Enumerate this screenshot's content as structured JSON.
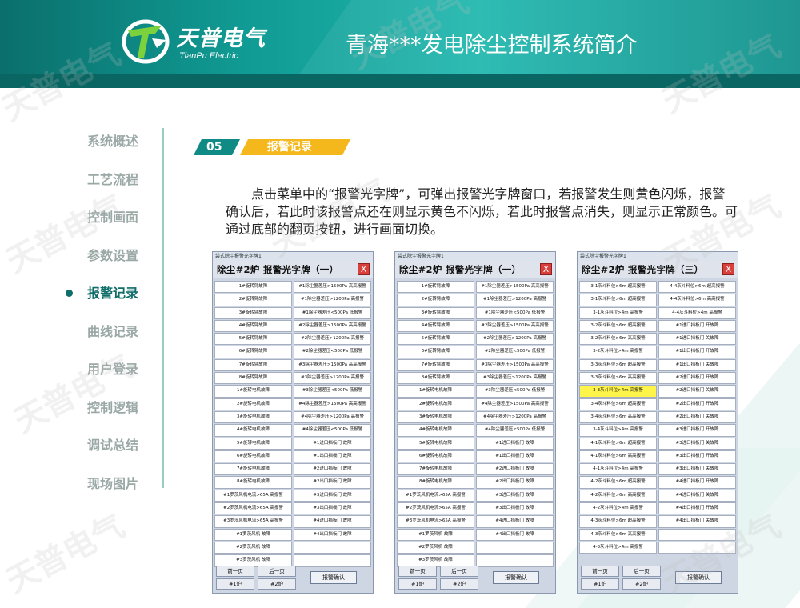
{
  "header": {
    "brand_cn": "天普电气",
    "brand_en": "TianPu Electric",
    "title": "青海***发电除尘控制系统简介"
  },
  "watermark": "天普电气",
  "nav": {
    "items": [
      {
        "label": "系统概述"
      },
      {
        "label": "工艺流程"
      },
      {
        "label": "控制画面"
      },
      {
        "label": "参数设置"
      },
      {
        "label": "报警记录",
        "active": true
      },
      {
        "label": "曲线记录"
      },
      {
        "label": "用户登录"
      },
      {
        "label": "控制逻辑"
      },
      {
        "label": "调试总结"
      },
      {
        "label": "现场图片"
      }
    ]
  },
  "section": {
    "number": "05",
    "name": "报警记录"
  },
  "description": "点击菜单中的“报警光字牌”，可弹出报警光字牌窗口，若报警发生则黄色闪烁，报警确认后，若此时该报警点还在则显示黄色不闪烁，若此时报警点消失，则显示正常颜色。可通过底部的翻页按钮，进行画面切换。",
  "colors": {
    "accent": "#0f8a85",
    "tag_yellow": "#f5b81c",
    "alarm_yellow": "#fff54a"
  },
  "windows": [
    {
      "bar": "袋式除尘报警光字牌1",
      "title": "除尘#2炉 报警光字牌（一）",
      "close": "X",
      "cells": [
        "1#旋转臂故障",
        "#1除尘器差压>1500Pa 高高报警",
        "2#旋转臂故障",
        "#1除尘器差压>1200Pa 高报警",
        "3#旋转臂故障",
        "#1除尘器差压<500Pa 低报警",
        "4#旋转臂故障",
        "#2除尘器差压>1500Pa 高高报警",
        "5#旋转臂故障",
        "#2除尘器差压>1200Pa 高报警",
        "6#旋转臂故障",
        "#2除尘器差压<500Pa 低报警",
        "7#旋转臂故障",
        "#3除尘器差压>1500Pa 高高报警",
        "8#旋转臂故障",
        "#3除尘器差压>1200Pa 高报警",
        "1#旋转电机故障",
        "#3除尘器差压<500Pa 低报警",
        "2#旋转电机故障",
        "#4除尘器差压>1500Pa 高高报警",
        "3#旋转电机故障",
        "#4除尘器差压>1200Pa 高报警",
        "4#旋转电机故障",
        "#4除尘器差压<500Pa 低报警",
        "5#旋转电机故障",
        "#1进口挡板门 故障",
        "6#旋转电机故障",
        "#1出口挡板门 故障",
        "7#旋转电机故障",
        "#2进口挡板门 故障",
        "8#旋转电机故障",
        "#2出口挡板门 故障",
        "#1罗茨风机电流>65A 高报警",
        "#3进口挡板门 故障",
        "#2罗茨风机电流>65A 高报警",
        "#3出口挡板门 故障",
        "#3罗茨风机电流>65A 高报警",
        "#4进口挡板门 故障",
        "#1罗茨风机 故障",
        "#4出口挡板门 故障",
        "#2罗茨风机 故障",
        "",
        "#3罗茨风机 故障",
        ""
      ],
      "prev": "前一页",
      "next": "后一页",
      "tab1": "#1炉",
      "tab2": "#2炉",
      "ack": "报警确认"
    },
    {
      "bar": "袋式除尘报警光字牌1",
      "title": "除尘#2炉 报警光字牌（一）",
      "close": "X",
      "cells": [
        "1#旋转臂故障",
        "#1除尘器差压>1500Pa 高高报警",
        "2#旋转臂故障",
        "#1除尘器差压>1200Pa 高报警",
        "3#旋转臂故障",
        "#1除尘器差压<500Pa 低报警",
        "4#旋转臂故障",
        "#2除尘器差压>1500Pa 高高报警",
        "5#旋转臂故障",
        "#2除尘器差压>1200Pa 高报警",
        "6#旋转臂故障",
        "#2除尘器差压<500Pa 低报警",
        "7#旋转臂故障",
        "#3除尘器差压>1500Pa 高高报警",
        "8#旋转臂故障",
        "#3除尘器差压>1200Pa 高报警",
        "1#旋转电机故障",
        "#3除尘器差压<500Pa 低报警",
        "2#旋转电机故障",
        "#4除尘器差压>1500Pa 高高报警",
        "3#旋转电机故障",
        "#4除尘器差压>1200Pa 高报警",
        "4#旋转电机故障",
        "#4除尘器差压<500Pa 低报警",
        "5#旋转电机故障",
        "#1进口挡板门 故障",
        "6#旋转电机故障",
        "#1出口挡板门 故障",
        "7#旋转电机故障",
        "#2进口挡板门 故障",
        "8#旋转电机故障",
        "#2出口挡板门 故障",
        "#1罗茨风机电流>65A 高报警",
        "#3进口挡板门 故障",
        "#2罗茨风机电流>65A 高报警",
        "#3出口挡板门 故障",
        "#3罗茨风机电流>65A 高报警",
        "#4进口挡板门 故障",
        "#1罗茨风机 故障",
        "#4出口挡板门 故障",
        "#2罗茨风机 故障",
        "",
        "#3罗茨风机 故障",
        ""
      ],
      "prev": "前一页",
      "next": "后一页",
      "tab1": "#1炉",
      "tab2": "#2炉",
      "ack": "报警确认"
    },
    {
      "bar": "袋式除尘报警光字牌1",
      "title": "除尘#2炉 报警光字牌（三）",
      "close": "X",
      "yellow_index": 16,
      "cells": [
        "3-1灰斗料位>6m 超高报警",
        "4-4灰斗料位>6m 超高报警",
        "3-1灰斗料位>6m 超高报警",
        "4-4灰斗料位>6m 高高报警",
        "3-1灰斗料位>4m 高报警",
        "4-4灰斗料位>4m 高报警",
        "3-2灰斗料位>6m 超高报警",
        "#1进口挡板门 开故障",
        "3-2灰斗料位>6m 高高报警",
        "#1进口挡板门 关故障",
        "3-2灰斗料位>4m 高报警",
        "#1出口挡板门 开故障",
        "3-3灰斗料位>6m 超高报警",
        "#1出口挡板门 关故障",
        "3-3灰斗料位>6m 高高报警",
        "#2进口挡板门 开故障",
        "3-3灰斗料位>4m 高报警",
        "#2进口挡板门 关故障",
        "3-4灰斗料位>6m 超高报警",
        "#2出口挡板门 开故障",
        "3-4灰斗料位>6m 高高报警",
        "#2出口挡板门 关故障",
        "3-4灰斗料位>4m 高报警",
        "#3进口挡板门 开故障",
        "4-1灰斗料位>6m 超高报警",
        "#3进口挡板门 关故障",
        "4-1灰斗料位>6m 高高报警",
        "#3出口挡板门 开故障",
        "4-1灰斗料位>4m 高报警",
        "#3出口挡板门 关故障",
        "4-2灰斗料位>6m 超高报警",
        "#4进口挡板门 开故障",
        "4-2灰斗料位>6m 高高报警",
        "#4进口挡板门 关故障",
        "4-2灰斗料位>4m 高报警",
        "#4出口挡板门 开故障",
        "4-3灰斗料位>6m 超高报警",
        "#4出口挡板门 关故障",
        "4-3灰斗料位>6m 高高报警",
        "",
        "4-3灰斗料位>4m 高报警",
        ""
      ],
      "prev": "前一页",
      "next": "后一页",
      "tab1": "#1炉",
      "tab2": "#2炉",
      "ack": "报警确认"
    }
  ]
}
